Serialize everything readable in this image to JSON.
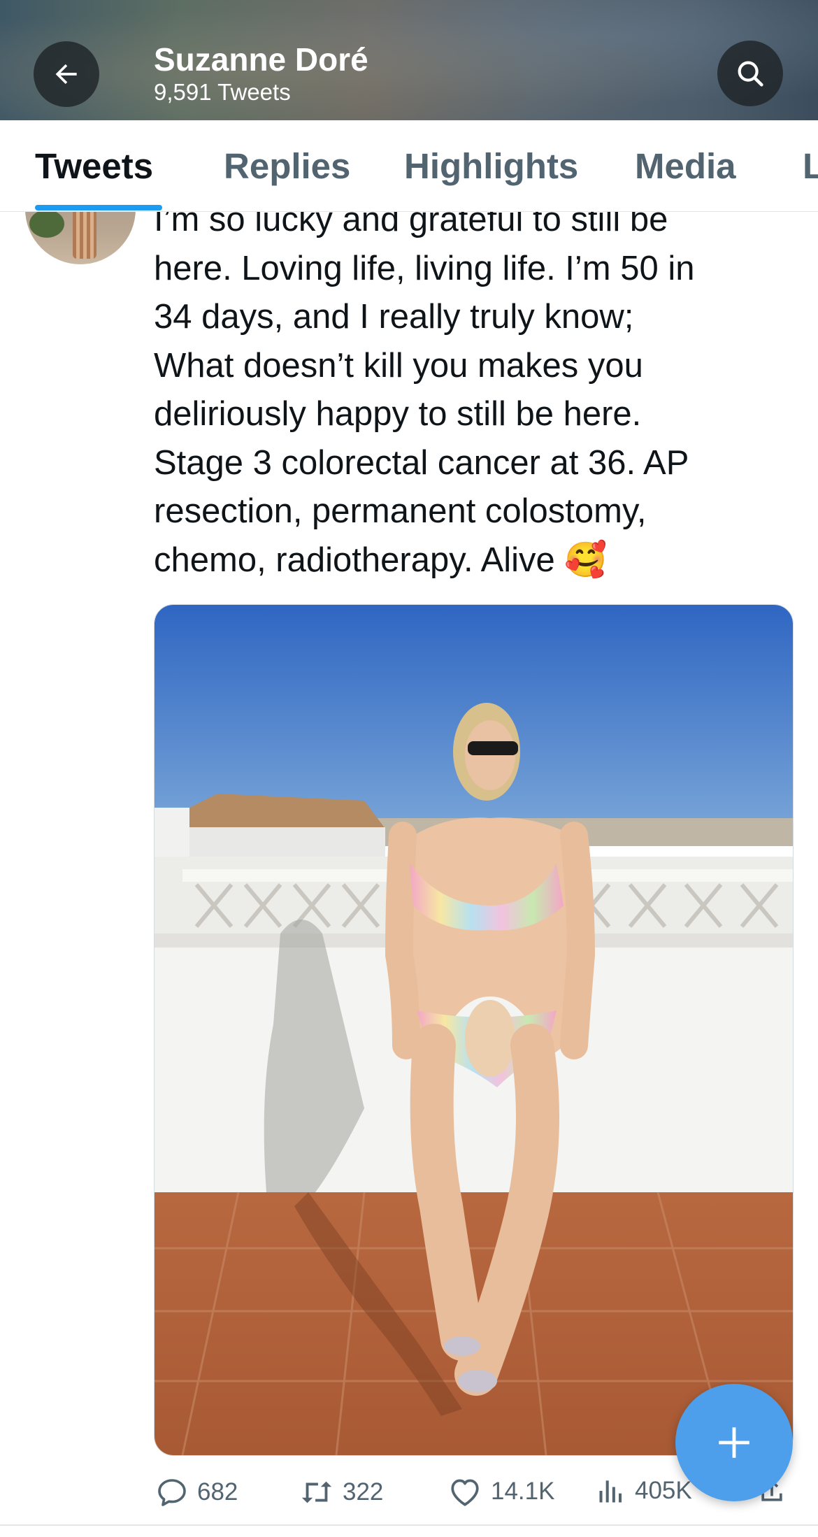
{
  "header": {
    "name": "Suzanne Doré",
    "tweet_count": "9,591 Tweets",
    "back_icon": "arrow-left-icon",
    "search_icon": "search-icon"
  },
  "tabs": [
    {
      "label": "Tweets",
      "active": true
    },
    {
      "label": "Replies",
      "active": false
    },
    {
      "label": "Highlights",
      "active": false
    },
    {
      "label": "Media",
      "active": false
    },
    {
      "label": "L",
      "active": false
    }
  ],
  "tweet": {
    "text": "I’m so lucky and grateful to still be\nhere. Loving life, living life. I’m 50 in\n34 days, and I really truly know;\nWhat doesn’t kill you makes you\ndeliriously happy to still be here.\nStage 3 colorectal cancer at 36. AP\nresection, permanent colostomy,\nchemo, radiotherapy. Alive 🥰",
    "actions": {
      "replies": "682",
      "retweets": "322",
      "likes": "14.1K",
      "views": "405K"
    }
  },
  "colors": {
    "accent": "#1d9bf0",
    "fab": "#4d9fec",
    "text_primary": "#0f1419",
    "text_secondary": "#536471"
  },
  "fab": {
    "icon": "plus-icon"
  }
}
